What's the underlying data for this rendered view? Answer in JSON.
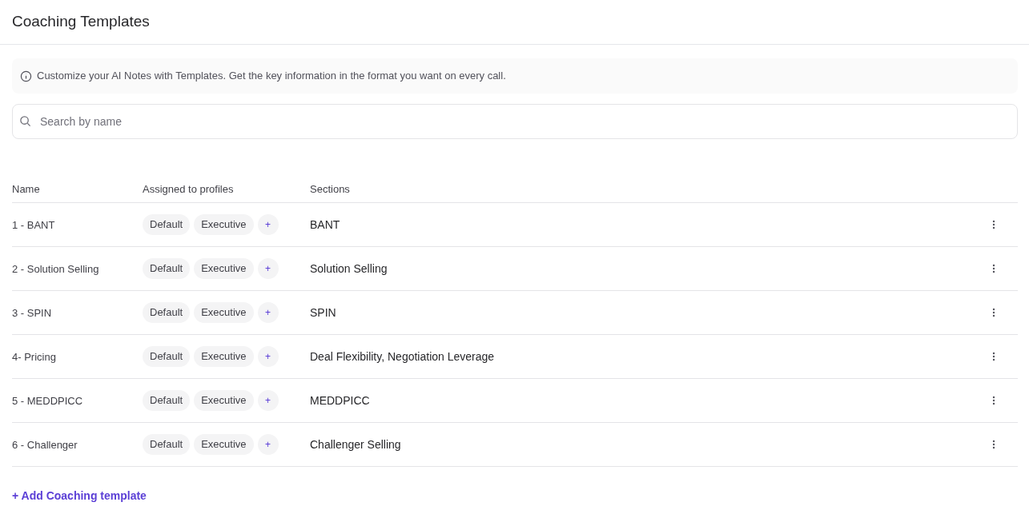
{
  "header": {
    "title": "Coaching Templates"
  },
  "info_banner": {
    "text": "Customize your AI Notes with Templates. Get the key information in the format you want on every call."
  },
  "search": {
    "placeholder": "Search by name"
  },
  "table": {
    "columns": [
      "Name",
      "Assigned to profiles",
      "Sections"
    ],
    "rows": [
      {
        "name": "1 - BANT",
        "profiles": [
          "Default",
          "Executive"
        ],
        "add_profile": "+",
        "sections": "BANT"
      },
      {
        "name": "2 - Solution Selling",
        "profiles": [
          "Default",
          "Executive"
        ],
        "add_profile": "+",
        "sections": "Solution Selling"
      },
      {
        "name": "3 - SPIN",
        "profiles": [
          "Default",
          "Executive"
        ],
        "add_profile": "+",
        "sections": "SPIN"
      },
      {
        "name": "4- Pricing",
        "profiles": [
          "Default",
          "Executive"
        ],
        "add_profile": "+",
        "sections": "Deal Flexibility, Negotiation Leverage"
      },
      {
        "name": "5 - MEDDPICC",
        "profiles": [
          "Default",
          "Executive"
        ],
        "add_profile": "+",
        "sections": "MEDDPICC"
      },
      {
        "name": "6 - Challenger",
        "profiles": [
          "Default",
          "Executive"
        ],
        "add_profile": "+",
        "sections": "Challenger Selling"
      }
    ]
  },
  "add_link": "+ Add Coaching template"
}
